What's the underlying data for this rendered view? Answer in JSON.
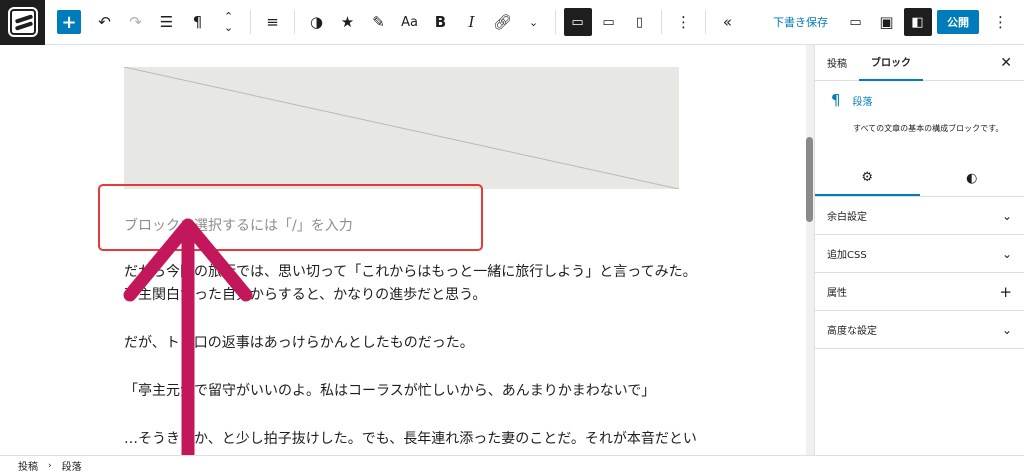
{
  "toolbar": {
    "add_icon": "plus-icon",
    "draft_save_label": "下書き保存",
    "publish_label": "公開"
  },
  "canvas": {
    "block_placeholder": "ブロックを選択するには「/」を入力",
    "paragraphs": [
      "だから今回の旅行では、思い切って「これからはもっと一緒に旅行しよう」と言ってみた。",
      "亭主関白だった自分からすると、かなりの進歩だと思う。",
      "だが、トヨ口の返事はあっけらかんとしたものだった。",
      "「亭主元気で留守がいいのよ。私はコーラスが忙しいから、あんまりかまわないで」",
      "…そうきたか、と少し拍子抜けした。でも、長年連れ添った妻のことだ。それが本音だとい"
    ],
    "highlight_color": "#e53a3a",
    "arrow_color": "#c2185b"
  },
  "sidebar": {
    "tabs": [
      "投稿",
      "ブロック"
    ],
    "block_name": "段落",
    "block_description": "すべての文章の基本の構成ブロックです。",
    "panels": [
      {
        "title": "余白設定",
        "icon": "chevron-down-icon"
      },
      {
        "title": "追加CSS",
        "icon": "chevron-down-icon"
      },
      {
        "title": "属性",
        "icon": "plus-icon"
      },
      {
        "title": "高度な設定",
        "icon": "chevron-down-icon"
      }
    ]
  },
  "breadcrumb": {
    "items": [
      "投稿",
      "段落"
    ]
  },
  "colors": {
    "accent": "#007cba",
    "dark": "#1e1e1e"
  }
}
